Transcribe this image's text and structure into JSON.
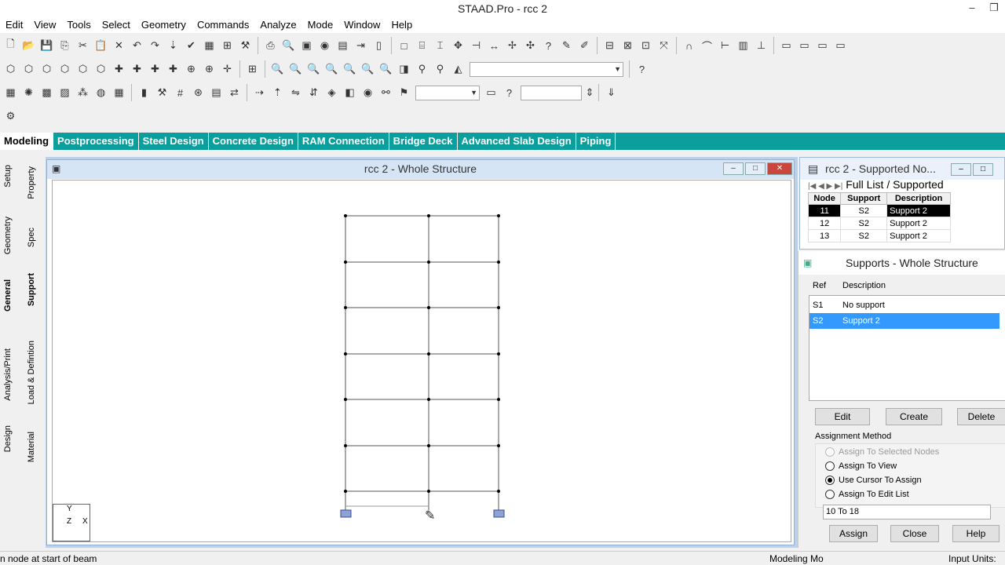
{
  "app": {
    "title": "STAAD.Pro - rcc 2"
  },
  "menu": [
    "Edit",
    "View",
    "Tools",
    "Select",
    "Geometry",
    "Commands",
    "Analyze",
    "Mode",
    "Window",
    "Help"
  ],
  "page_tabs": [
    {
      "label": "Modeling",
      "active": true
    },
    {
      "label": "Postprocessing",
      "active": false
    },
    {
      "label": "Steel Design",
      "active": false
    },
    {
      "label": "Concrete Design",
      "active": false
    },
    {
      "label": "RAM Connection",
      "active": false
    },
    {
      "label": "Bridge Deck",
      "active": false
    },
    {
      "label": "Advanced Slab Design",
      "active": false
    },
    {
      "label": "Piping",
      "active": false
    }
  ],
  "sidebar_primary": [
    "Setup",
    "Geometry",
    "General",
    "Analysis/Print",
    "Design"
  ],
  "sidebar_secondary": [
    "Property",
    "Spec",
    "Support",
    "Load & Defintion",
    "Material"
  ],
  "view_window": {
    "title": "rcc 2 - Whole Structure"
  },
  "supported_nodes_window": {
    "title": "rcc 2 - Supported No...",
    "tabs": [
      "Full List",
      "Supported"
    ],
    "columns": [
      "Node",
      "Support",
      "Description"
    ],
    "rows": [
      {
        "node": "11",
        "support": "S2",
        "description": "Support 2",
        "selected": true
      },
      {
        "node": "12",
        "support": "S2",
        "description": "Support 2",
        "selected": false
      },
      {
        "node": "13",
        "support": "S2",
        "description": "Support 2",
        "selected": false
      }
    ]
  },
  "supports_panel": {
    "title": "Supports - Whole Structure",
    "col_ref": "Ref",
    "col_desc": "Description",
    "items": [
      {
        "ref": "S1",
        "desc": "No support",
        "selected": false
      },
      {
        "ref": "S2",
        "desc": "Support 2",
        "selected": true
      }
    ],
    "buttons": {
      "edit": "Edit",
      "create": "Create",
      "delete": "Delete"
    },
    "assignment_method_label": "Assignment Method",
    "methods": [
      {
        "label": "Assign To Selected Nodes",
        "checked": false,
        "disabled": true
      },
      {
        "label": "Assign To View",
        "checked": false,
        "disabled": false
      },
      {
        "label": "Use Cursor To Assign",
        "checked": true,
        "disabled": false
      },
      {
        "label": "Assign To Edit List",
        "checked": false,
        "disabled": false
      }
    ],
    "edit_list_value": "10 To 18",
    "footer_buttons": {
      "assign": "Assign",
      "close": "Close",
      "help": "Help"
    }
  },
  "status": {
    "left": "n node at start of beam",
    "mode": "Modeling Mo",
    "units": "Input Units: "
  },
  "axis": {
    "y": "Y",
    "x": "X",
    "z": "Z"
  },
  "colors": {
    "accent_tabs": "#0a9e9c",
    "selection": "#3399ff",
    "frame": "#444444"
  }
}
